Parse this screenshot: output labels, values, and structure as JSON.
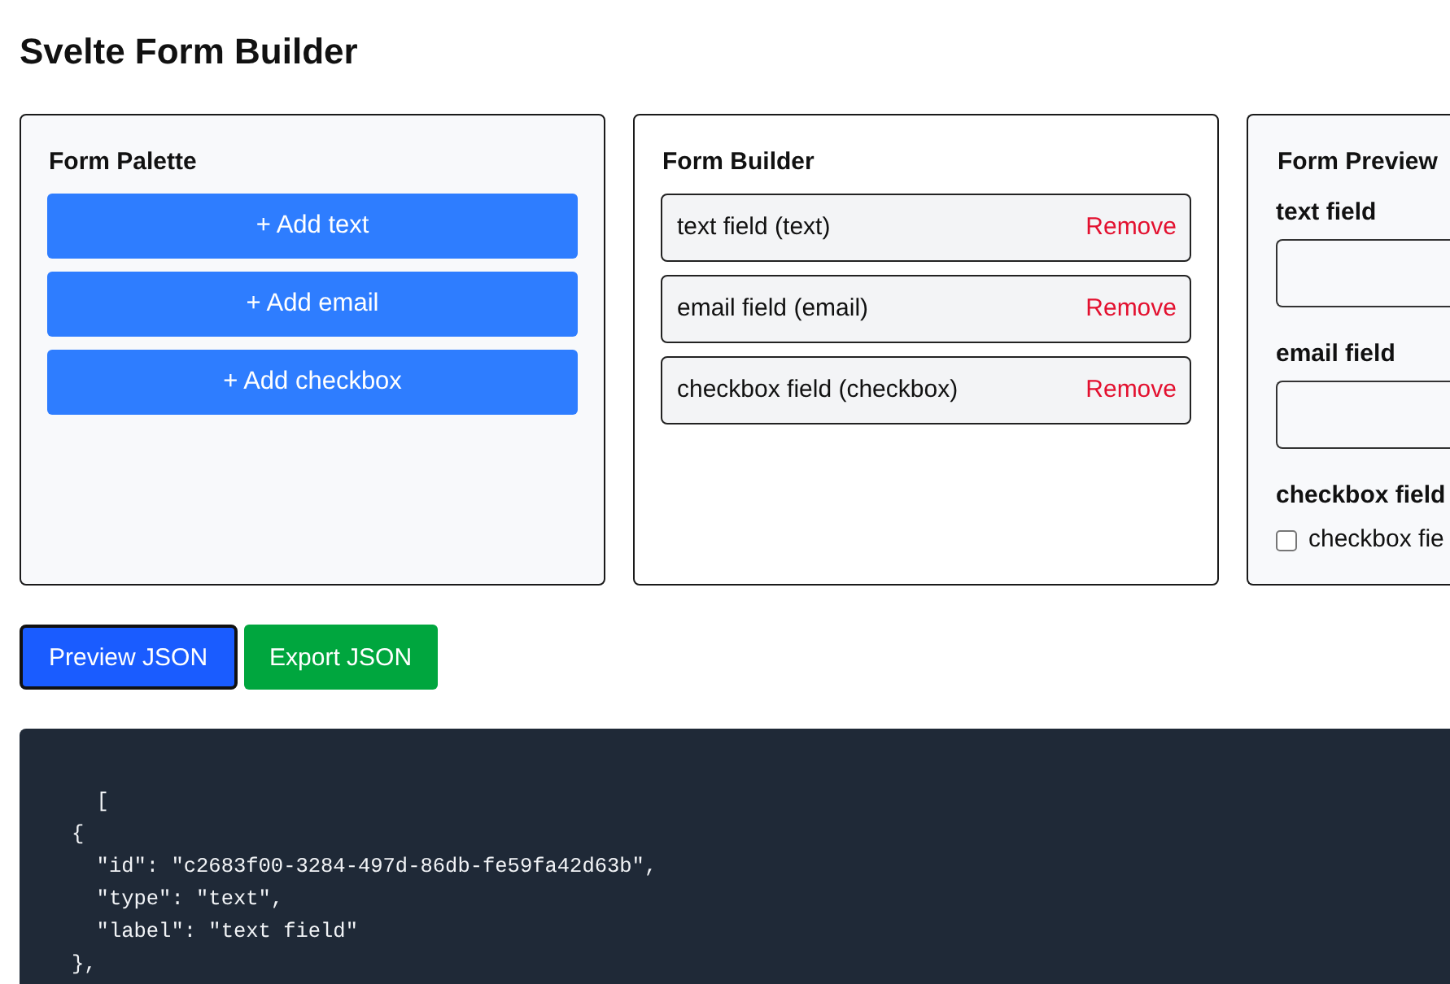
{
  "page": {
    "title": "Svelte Form Builder"
  },
  "palette": {
    "title": "Form Palette",
    "buttons": [
      "+ Add text",
      "+ Add email",
      "+ Add checkbox"
    ]
  },
  "builder": {
    "title": "Form Builder",
    "items": [
      {
        "label": "text field (text)",
        "action": "Remove"
      },
      {
        "label": "email field (email)",
        "action": "Remove"
      },
      {
        "label": "checkbox field (checkbox)",
        "action": "Remove"
      }
    ]
  },
  "preview": {
    "title": "Form Preview",
    "fields": [
      {
        "kind": "input",
        "label": "text field"
      },
      {
        "kind": "input",
        "label": "email field"
      },
      {
        "kind": "checkbox",
        "label": "checkbox field",
        "option": "checkbox fie",
        "checked": false
      }
    ]
  },
  "actions": [
    {
      "label": "Preview JSON",
      "kind": "primary",
      "focused": true
    },
    {
      "label": "Export JSON",
      "kind": "success",
      "focused": false
    }
  ],
  "json_output": {
    "lines": [
      "  [",
      "{",
      "  \"id\": \"c2683f00-3284-497d-86db-fe59fa42d63b\",",
      "  \"type\": \"text\",",
      "  \"label\": \"text field\"",
      "},"
    ]
  }
}
